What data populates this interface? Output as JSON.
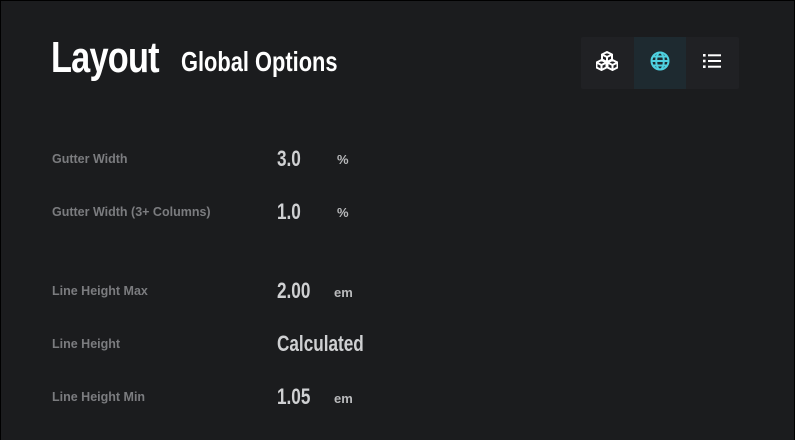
{
  "header": {
    "title": "Layout",
    "subtitle": "Global Options"
  },
  "toolbar": {
    "buttons": [
      {
        "icon": "boxes-icon",
        "active": false
      },
      {
        "icon": "globe-icon",
        "active": true
      },
      {
        "icon": "list-icon",
        "active": false
      }
    ],
    "accent_color": "#4fd1e0"
  },
  "options": [
    {
      "label": "Gutter Width",
      "value": "3.0",
      "unit": "%"
    },
    {
      "label": "Gutter Width (3+ Columns)",
      "value": "1.0",
      "unit": "%"
    },
    {
      "label": "Line Height Max",
      "value": "2.00",
      "unit": "em"
    },
    {
      "label": "Line Height",
      "value": "Calculated",
      "unit": ""
    },
    {
      "label": "Line Height Min",
      "value": "1.05",
      "unit": "em"
    }
  ]
}
